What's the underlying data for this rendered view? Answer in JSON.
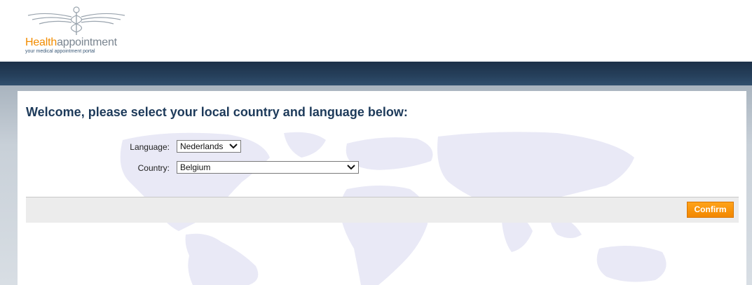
{
  "logo": {
    "brand_part1": "Health",
    "brand_part2": "appointment",
    "tagline": "your medical appointment portal"
  },
  "welcome": {
    "heading": "Welcome, please select your local country and language below:"
  },
  "form": {
    "language_label": "Language:",
    "language_value": "Nederlands",
    "country_label": "Country:",
    "country_value": "Belgium"
  },
  "actions": {
    "confirm_label": "Confirm"
  },
  "colors": {
    "navbar": "#1d3148",
    "accent": "#f28c00",
    "heading": "#1d3a5a"
  },
  "icons": [
    "caduceus-logo-icon",
    "chevron-down-icon",
    "world-map-background"
  ]
}
